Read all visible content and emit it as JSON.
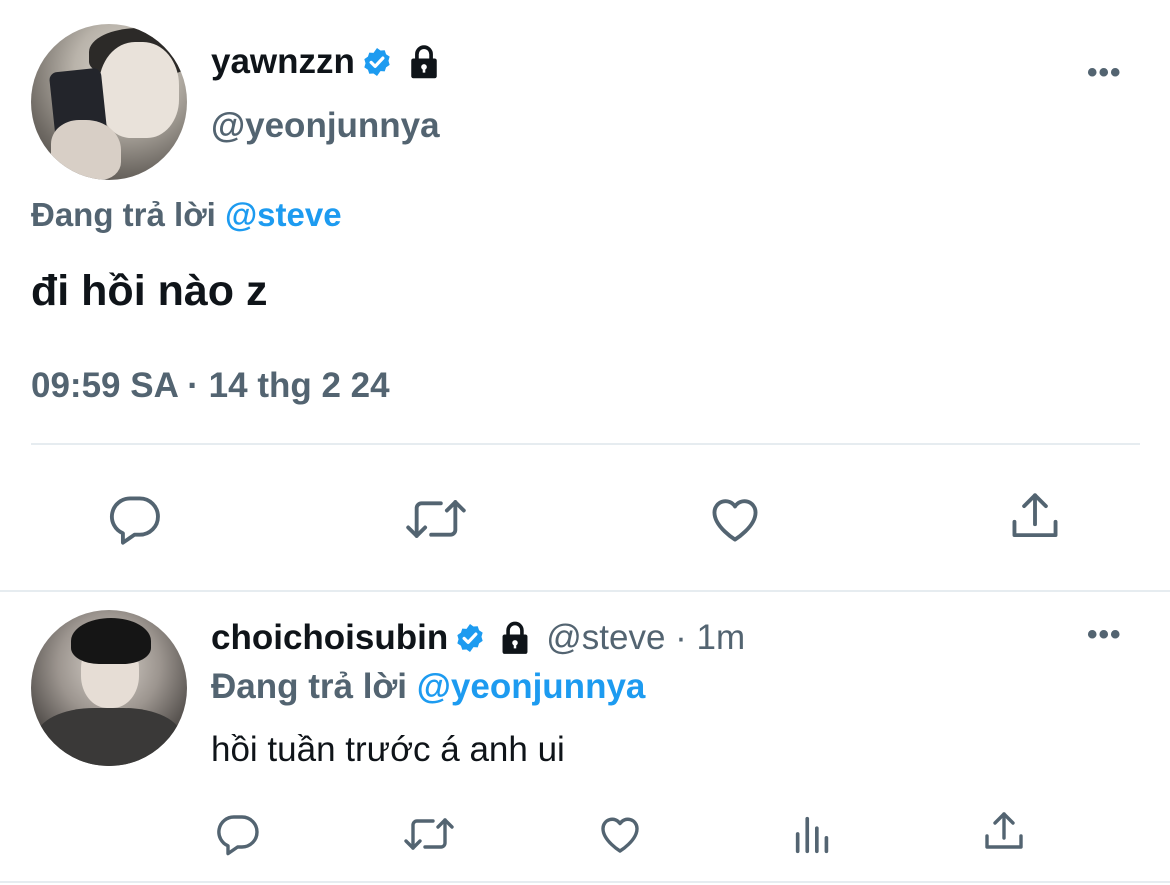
{
  "main_tweet": {
    "display_name": "yawnzzn",
    "handle": "@yeonjunnya",
    "replying_to_label": "Đang trả lời",
    "replying_to_handle": "@steve",
    "text": "đi hồi nào z",
    "timestamp": "09:59 SA · 14 thg 2 24",
    "icons": [
      "verified-badge-icon",
      "lock-icon",
      "more-icon",
      "reply-icon",
      "retweet-icon",
      "like-icon",
      "share-icon"
    ]
  },
  "reply_tweet": {
    "display_name": "choichoisubin",
    "handle": "@steve",
    "separator": "·",
    "time_ago": "1m",
    "replying_to_label": "Đang trả lời",
    "replying_to_handle": "@yeonjunnya",
    "text": "hồi tuần trước á anh ui",
    "icons": [
      "verified-badge-icon",
      "lock-icon",
      "more-icon",
      "reply-icon",
      "retweet-icon",
      "like-icon",
      "analytics-icon",
      "share-icon"
    ]
  },
  "more_glyph": "•••",
  "colors": {
    "accent": "#1d9bf0",
    "secondary_text": "#536471",
    "primary_text": "#0f1419",
    "divider": "#e6ecf0"
  }
}
